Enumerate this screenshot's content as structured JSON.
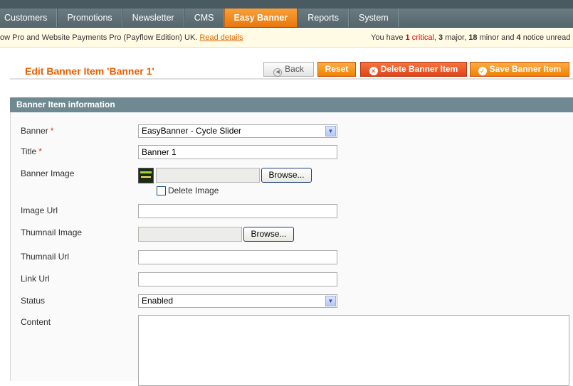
{
  "nav": {
    "items": [
      {
        "label": "Customers"
      },
      {
        "label": "Promotions"
      },
      {
        "label": "Newsletter"
      },
      {
        "label": "CMS"
      },
      {
        "label": "Easy Banner",
        "active": true
      },
      {
        "label": "Reports"
      },
      {
        "label": "System"
      }
    ]
  },
  "notice": {
    "text": "ow Pro and Website Payments Pro (Payflow Edition) UK.",
    "link": "Read details",
    "summary_prefix": "You have",
    "critical_count": "1",
    "critical_label": "critical",
    "major_count": "3",
    "major_label": "major,",
    "minor_count": "18",
    "minor_label": "minor and",
    "notice_count": "4",
    "notice_label": "notice unread m"
  },
  "page": {
    "title": "Edit Banner Item 'Banner 1'"
  },
  "buttons": {
    "back": "Back",
    "reset": "Reset",
    "delete": "Delete Banner Item",
    "save": "Save Banner Item"
  },
  "fieldset": {
    "title": "Banner Item information"
  },
  "form": {
    "banner_label": "Banner",
    "banner_value": "EasyBanner - Cycle Slider",
    "title_label": "Title",
    "title_value": "Banner 1",
    "banner_image_label": "Banner Image",
    "browse_label": "Browse...",
    "delete_image_label": "Delete Image",
    "image_url_label": "Image Url",
    "image_url_value": "",
    "thumbnail_image_label": "Thumnail Image",
    "thumbnail_url_label": "Thumnail Url",
    "thumbnail_url_value": "",
    "link_url_label": "Link Url",
    "link_url_value": "",
    "status_label": "Status",
    "status_value": "Enabled",
    "content_label": "Content",
    "required_mark": "*"
  },
  "colors": {
    "accent": "#eb5e00",
    "nav_active": "#f18200",
    "fieldset_header": "#6f8992",
    "critical": "#dd0000"
  }
}
